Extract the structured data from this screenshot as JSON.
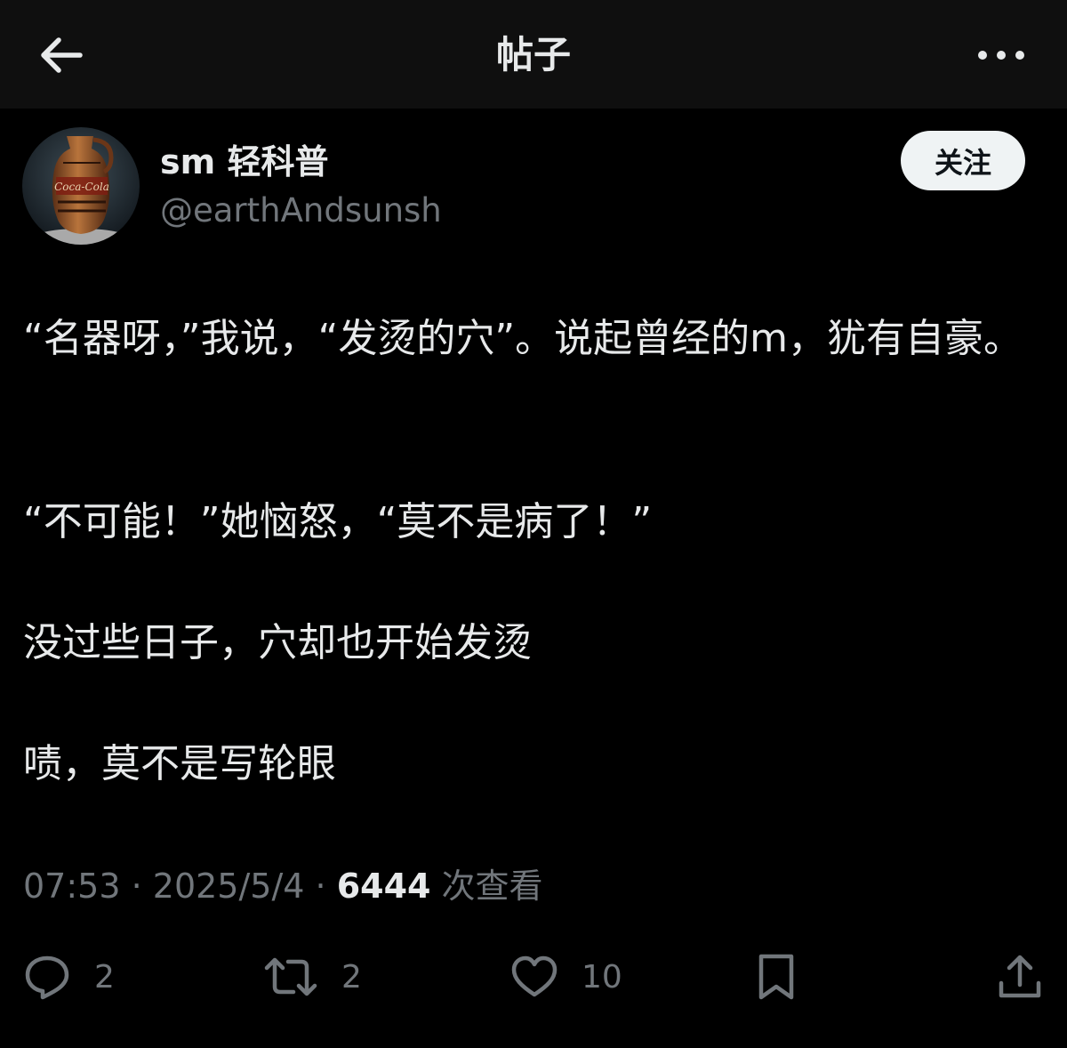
{
  "header": {
    "title": "帖子"
  },
  "author": {
    "display_name": "sm 轻科普",
    "handle": "@earthAndsunsh",
    "follow_label": "关注",
    "avatar_logo_text": "Coca-Cola"
  },
  "post": {
    "paragraphs": [
      "“名器呀，”我说，“发烫的穴”。说起曾经的m，犹有自豪。",
      "“不可能！”她恼怒，“莫不是病了！”",
      "没过些日子，穴却也开始发烫",
      "啧，莫不是写轮眼"
    ],
    "time": "07:53",
    "date": "2025/5/4",
    "views": "6444",
    "views_label": "次查看"
  },
  "actions": {
    "replies": "2",
    "reposts": "2",
    "likes": "10"
  },
  "icons": {
    "back": "arrow-left-icon",
    "more": "more-dots-icon",
    "reply": "reply-icon",
    "repost": "repost-icon",
    "like": "heart-icon",
    "bookmark": "bookmark-icon",
    "share": "share-icon"
  },
  "colors": {
    "background": "#000000",
    "header_background": "#0f0f0f",
    "text_primary": "#e7e9ea",
    "text_secondary": "#71767b",
    "follow_button_bg": "#eff3f4"
  }
}
